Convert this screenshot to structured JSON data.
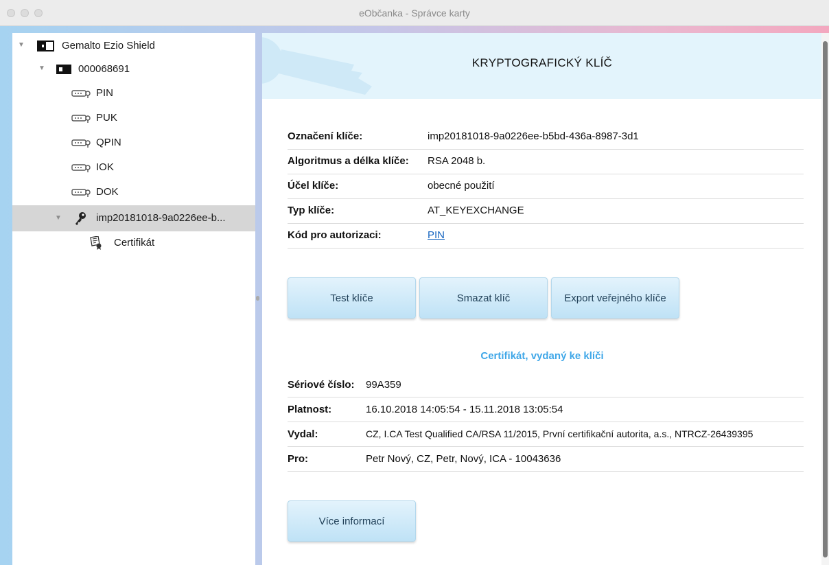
{
  "window": {
    "title": "eObčanka - Správce karty"
  },
  "tree": {
    "root": "Gemalto Ezio Shield",
    "card": "000068691",
    "items": [
      "PIN",
      "PUK",
      "QPIN",
      "IOK",
      "DOK"
    ],
    "selected_key": "imp20181018-9a0226ee-b...",
    "certificate": "Certifikát"
  },
  "header": {
    "title": "KRYPTOGRAFICKÝ KLÍČ"
  },
  "key_details": {
    "label_name": "Označení klíče:",
    "value_name": "imp20181018-9a0226ee-b5bd-436a-8987-3d1",
    "label_algorithm": "Algoritmus a délka klíče:",
    "value_algorithm": "RSA 2048 b.",
    "label_purpose": "Účel klíče:",
    "value_purpose": "obecné použití",
    "label_type": "Typ klíče:",
    "value_type": "AT_KEYEXCHANGE",
    "label_auth": "Kód pro autorizaci:",
    "value_auth": "PIN"
  },
  "buttons": {
    "test": "Test klíče",
    "delete": "Smazat klíč",
    "export": "Export veřejného klíče",
    "more": "Více informací"
  },
  "certificate": {
    "heading": "Certifikát, vydaný ke klíči",
    "label_serial": "Sériové číslo:",
    "value_serial": "99A359",
    "label_validity": "Platnost:",
    "value_validity": "16.10.2018 14:05:54 - 15.11.2018 13:05:54",
    "label_issuer": "Vydal:",
    "value_issuer": "CZ, I.CA Test Qualified CA/RSA 11/2015, První certifikační autorita, a.s., NTRCZ-26439395",
    "label_subject": "Pro:",
    "value_subject": "Petr Nový, CZ, Petr, Nový, ICA - 10043636"
  },
  "colors": {
    "accent": "#3fa7e8",
    "button": "#bfe2f6",
    "selection": "#d6d6d6"
  }
}
